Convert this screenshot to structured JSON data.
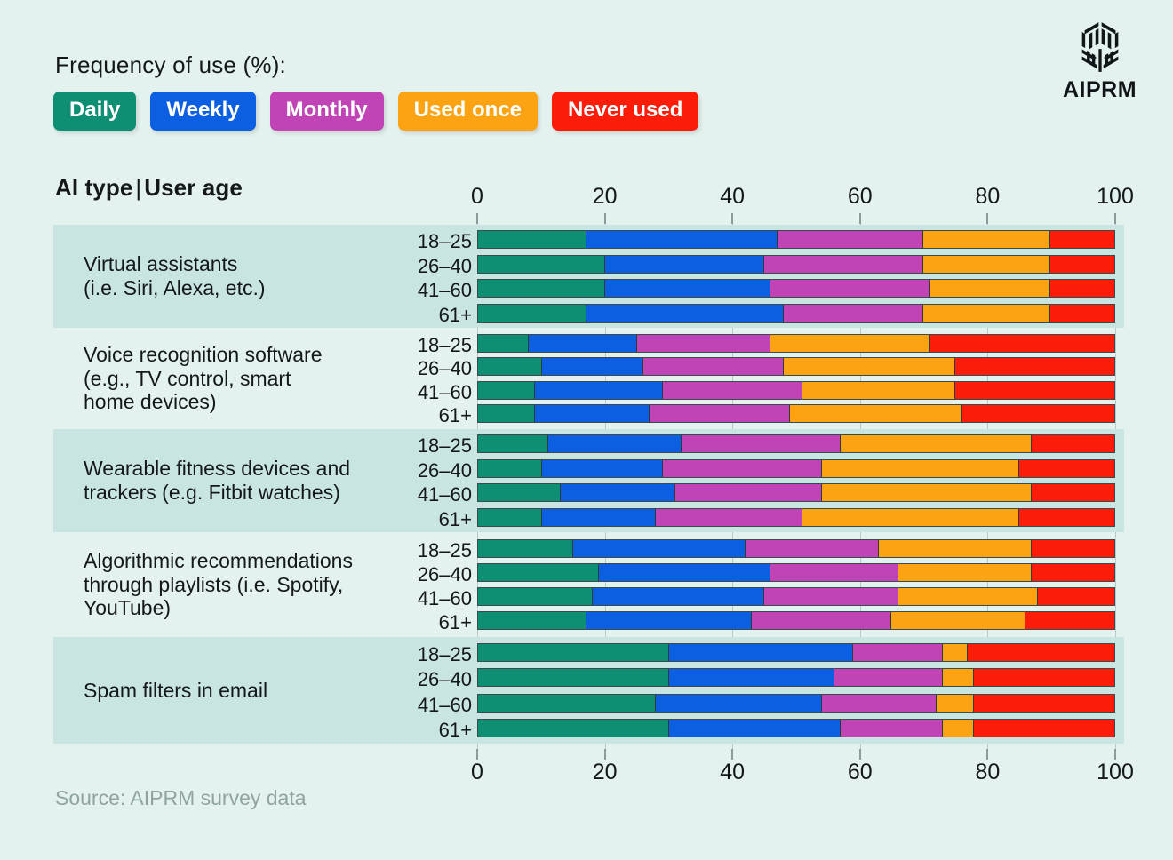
{
  "brand": {
    "logo_icon": "aiprm-cube-icon",
    "wordmark": "AIPRM"
  },
  "legend": {
    "title": "Frequency of use  (%):",
    "items": [
      {
        "label": "Daily",
        "color": "#0e8e72"
      },
      {
        "label": "Weekly",
        "color": "#0b5fe0"
      },
      {
        "label": "Monthly",
        "color": "#c044b6"
      },
      {
        "label": "Used once",
        "color": "#fba313"
      },
      {
        "label": "Never used",
        "color": "#fc1c0a"
      }
    ]
  },
  "header": {
    "left_title_a": "AI type",
    "divider": "|",
    "left_title_b": "User age"
  },
  "axis": {
    "ticks": [
      0,
      20,
      40,
      60,
      80,
      100
    ],
    "tick_labels": [
      "0",
      "20",
      "40",
      "60",
      "80",
      "100"
    ]
  },
  "source": "Source: AIPRM survey data",
  "chart_data": {
    "type": "bar",
    "orientation": "horizontal",
    "stacked": true,
    "stack_mode": "percent",
    "title": "Frequency of use  (%):",
    "xlabel": "",
    "ylabel": "AI type | User age",
    "xlim": [
      0,
      100
    ],
    "grid": true,
    "legend_position": "top-left",
    "series": [
      {
        "name": "Daily",
        "color": "#0e8e72"
      },
      {
        "name": "Weekly",
        "color": "#0b5fe0"
      },
      {
        "name": "Monthly",
        "color": "#c044b6"
      },
      {
        "name": "Used once",
        "color": "#fba313"
      },
      {
        "name": "Never used",
        "color": "#fc1c0a"
      }
    ],
    "age_groups": [
      "18–25",
      "26–40",
      "41–60",
      "61+"
    ],
    "groups": [
      {
        "category": "Virtual assistants\n(i.e. Siri, Alexa, etc.)",
        "category_lines": [
          "Virtual assistants",
          "(i.e. Siri, Alexa, etc.)"
        ],
        "shaded": true,
        "rows": [
          {
            "age": "18–25",
            "values": [
              17,
              30,
              23,
              20,
              10
            ]
          },
          {
            "age": "26–40",
            "values": [
              20,
              25,
              25,
              20,
              10
            ]
          },
          {
            "age": "41–60",
            "values": [
              20,
              26,
              25,
              19,
              10
            ]
          },
          {
            "age": "61+",
            "values": [
              17,
              31,
              22,
              20,
              10
            ]
          }
        ]
      },
      {
        "category": "Voice recognition software\n(e.g., TV control, smart\nhome devices)",
        "category_lines": [
          "Voice recognition software",
          "(e.g., TV control, smart",
          "home devices)"
        ],
        "shaded": false,
        "rows": [
          {
            "age": "18–25",
            "values": [
              8,
              17,
              21,
              25,
              29
            ]
          },
          {
            "age": "26–40",
            "values": [
              10,
              16,
              22,
              27,
              25
            ]
          },
          {
            "age": "41–60",
            "values": [
              9,
              20,
              22,
              24,
              25
            ]
          },
          {
            "age": "61+",
            "values": [
              9,
              18,
              22,
              27,
              24
            ]
          }
        ]
      },
      {
        "category": "Wearable fitness devices and\ntrackers (e.g. Fitbit watches)",
        "category_lines": [
          "Wearable fitness devices and",
          "trackers (e.g. Fitbit watches)"
        ],
        "shaded": true,
        "rows": [
          {
            "age": "18–25",
            "values": [
              11,
              21,
              25,
              30,
              13
            ]
          },
          {
            "age": "26–40",
            "values": [
              10,
              19,
              25,
              31,
              15
            ]
          },
          {
            "age": "41–60",
            "values": [
              13,
              18,
              23,
              33,
              13
            ]
          },
          {
            "age": "61+",
            "values": [
              10,
              18,
              23,
              34,
              15
            ]
          }
        ]
      },
      {
        "category": "Algorithmic recommendations\nthrough playlists (i.e. Spotify,\nYouTube)",
        "category_lines": [
          "Algorithmic recommendations",
          "through playlists (i.e. Spotify,",
          "YouTube)"
        ],
        "shaded": false,
        "rows": [
          {
            "age": "18–25",
            "values": [
              15,
              27,
              21,
              24,
              13
            ]
          },
          {
            "age": "26–40",
            "values": [
              19,
              27,
              20,
              21,
              13
            ]
          },
          {
            "age": "41–60",
            "values": [
              18,
              27,
              21,
              22,
              12
            ]
          },
          {
            "age": "61+",
            "values": [
              17,
              26,
              22,
              21,
              14
            ]
          }
        ]
      },
      {
        "category": "Spam filters in email",
        "category_lines": [
          "Spam filters in email"
        ],
        "shaded": true,
        "rows": [
          {
            "age": "18–25",
            "values": [
              30,
              29,
              14,
              4,
              23
            ]
          },
          {
            "age": "26–40",
            "values": [
              30,
              26,
              17,
              5,
              22
            ]
          },
          {
            "age": "41–60",
            "values": [
              28,
              26,
              18,
              6,
              22
            ]
          },
          {
            "age": "61+",
            "values": [
              30,
              27,
              16,
              5,
              22
            ]
          }
        ]
      }
    ]
  }
}
